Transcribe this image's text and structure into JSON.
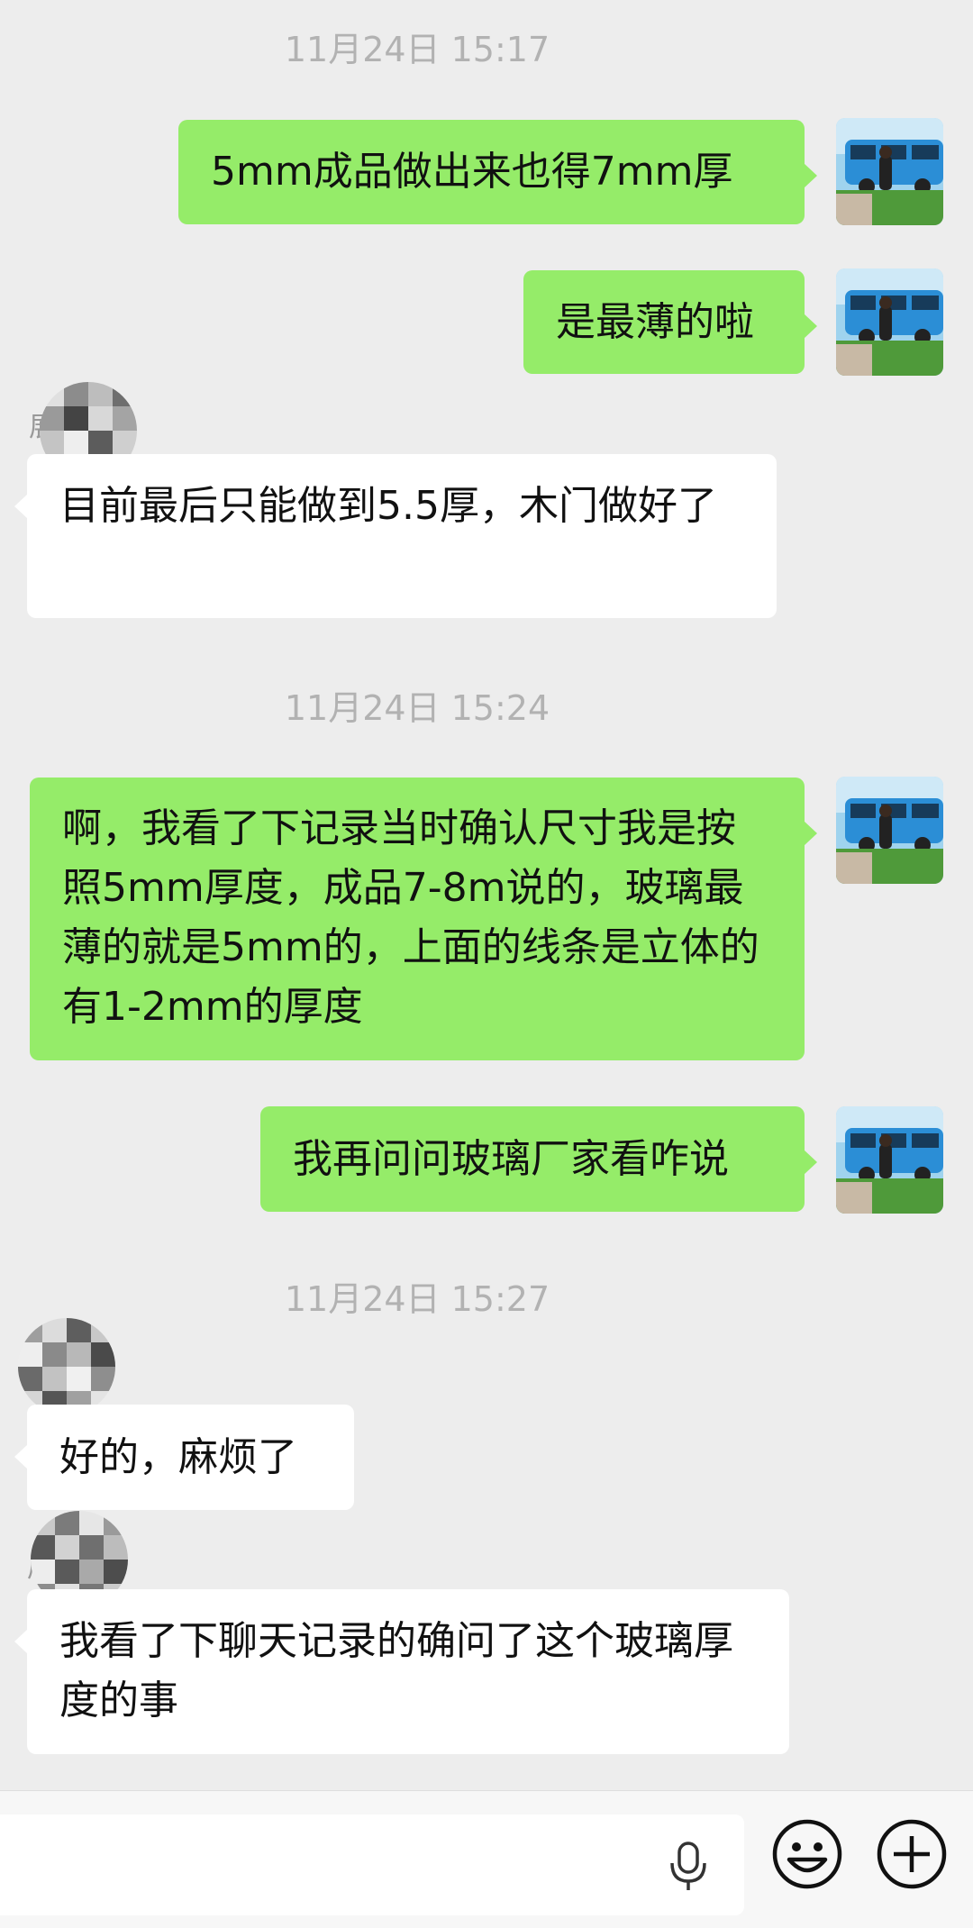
{
  "timestamps": [
    "11月24日 15:17",
    "11月24日 15:24",
    "11月24日 15:27"
  ],
  "messages": [
    {
      "text": "5mm成品做出来也得7mm厚"
    },
    {
      "text": "是最薄的啦"
    },
    {
      "text": "目前最后只能做到5.5厚，木门做好了"
    },
    {
      "text": "啊，我看了下记录当时确认尺寸我是按照5mm厚度，成品7-8m说的，玻璃最薄的就是5mm的，上面的线条是立体的有1-2mm的厚度"
    },
    {
      "text": "我再问问玻璃厂家看咋说"
    },
    {
      "text": "好的，麻烦了"
    },
    {
      "text": "我看了下聊天记录的确问了这个玻璃厚度的事"
    }
  ],
  "nicknames": [
    "展",
    "",
    "展"
  ],
  "input": {
    "placeholder": ""
  },
  "icons": {
    "mic": "mic-icon",
    "emoji": "emoji-icon",
    "plus": "plus-icon"
  },
  "colors": {
    "background": "#ededed",
    "my_bubble": "#95ec69",
    "other_bubble": "#ffffff",
    "timestamp": "#b2b2b2"
  }
}
